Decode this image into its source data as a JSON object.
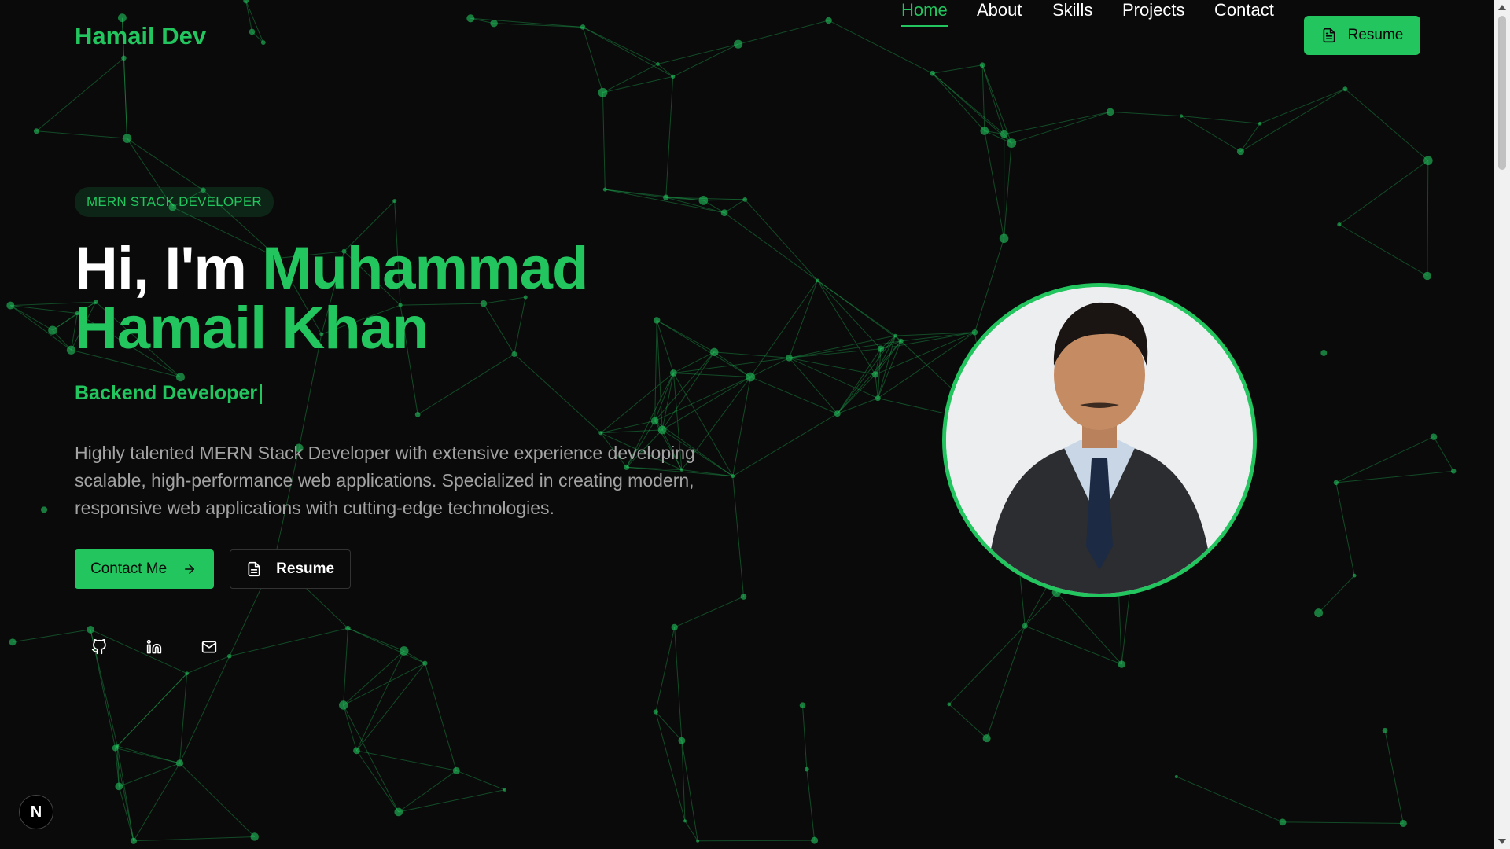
{
  "nav": {
    "brand": "Hamail Dev",
    "links": [
      {
        "label": "Home",
        "active": true
      },
      {
        "label": "About",
        "active": false
      },
      {
        "label": "Skills",
        "active": false
      },
      {
        "label": "Projects",
        "active": false
      },
      {
        "label": "Contact",
        "active": false
      }
    ],
    "resume_label": "Resume",
    "resume_icon": "file-text-icon"
  },
  "hero": {
    "badge": "MERN STACK DEVELOPER",
    "greeting": "Hi, I'm ",
    "name_line1": "Muhammad",
    "name_line2": "Hamail Khan",
    "role": "Backend Developer",
    "description": "Highly talented MERN Stack Developer with extensive experience developing scalable, high-performance web applications. Specialized in creating modern, responsive web applications with cutting-edge technologies.",
    "contact_label": "Contact Me",
    "contact_icon": "arrow-right-icon",
    "resume_label": "Resume",
    "resume_icon": "file-text-icon",
    "socials": [
      {
        "name": "github",
        "icon": "github-icon"
      },
      {
        "name": "linkedin",
        "icon": "linkedin-icon"
      },
      {
        "name": "email",
        "icon": "mail-icon"
      }
    ]
  },
  "portrait": {
    "subject": "profile-photo"
  },
  "dev_indicator": {
    "label": "N"
  },
  "colors": {
    "background": "#0a0a0a",
    "accent": "#22c55e",
    "text": "#ffffff",
    "muted": "#a3a3a3"
  }
}
